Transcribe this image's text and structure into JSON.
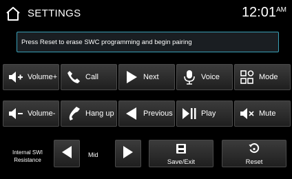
{
  "header": {
    "title": "SETTINGS",
    "time": "12:01",
    "ampm": "AM",
    "home_icon": "home-icon"
  },
  "message": "Press Reset to erase SWC programming and begin pairing",
  "row1": [
    {
      "label": "Volume+",
      "icon": "volume-up-icon"
    },
    {
      "label": "Call",
      "icon": "phone-icon"
    },
    {
      "label": "Next",
      "icon": "next-arrow-icon"
    },
    {
      "label": "Voice",
      "icon": "microphone-icon"
    },
    {
      "label": "Mode",
      "icon": "mode-grid-icon"
    }
  ],
  "row2": [
    {
      "label": "Volume-",
      "icon": "volume-down-icon"
    },
    {
      "label": "Hang up",
      "icon": "hang-up-icon"
    },
    {
      "label": "Previous",
      "icon": "previous-arrow-icon"
    },
    {
      "label": "Play",
      "icon": "play-pause-icon"
    },
    {
      "label": "Mute",
      "icon": "mute-icon"
    }
  ],
  "resistance": {
    "label_line1": "Internal SWI",
    "label_line2": "Resistance",
    "value": "Mid"
  },
  "actions": {
    "save_exit": "Save/Exit",
    "reset": "Reset"
  },
  "colors": {
    "accent_border": "#3aa1b8",
    "button_top": "#3b3b3b",
    "button_bottom": "#1f1f1f",
    "background": "#000000"
  }
}
